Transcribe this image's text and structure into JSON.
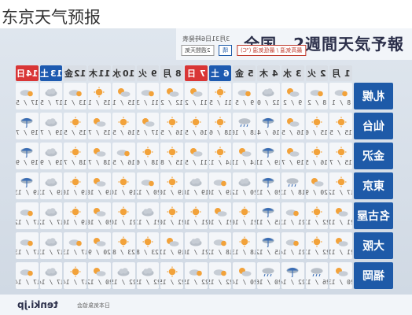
{
  "page": {
    "title": "东京天气预报"
  },
  "header": {
    "title": "全国　2週間天気予報",
    "date": "3月31日6時発表"
  },
  "legend": [
    {
      "label": "2週間天気",
      "style": "plain"
    },
    {
      "label": "晴",
      "style": "blue"
    },
    {
      "label": "最高気温 / 最低気温 (℃)",
      "style": "red"
    }
  ],
  "days": [
    {
      "num": "1",
      "name": "月",
      "type": "weekday"
    },
    {
      "num": "2",
      "name": "火",
      "type": "weekday"
    },
    {
      "num": "3",
      "name": "水",
      "type": "weekday"
    },
    {
      "num": "4",
      "name": "木",
      "type": "weekday"
    },
    {
      "num": "5",
      "name": "金",
      "type": "weekday"
    },
    {
      "num": "6",
      "name": "土",
      "type": "sat"
    },
    {
      "num": "7",
      "name": "日",
      "type": "sun"
    },
    {
      "num": "8",
      "name": "月",
      "type": "weekday"
    },
    {
      "num": "9",
      "name": "火",
      "type": "weekday"
    },
    {
      "num": "10",
      "name": "水",
      "type": "weekday"
    },
    {
      "num": "11",
      "name": "木",
      "type": "weekday"
    },
    {
      "num": "12",
      "name": "金",
      "type": "weekday"
    },
    {
      "num": "13",
      "name": "土",
      "type": "sat"
    },
    {
      "num": "14",
      "name": "日",
      "type": "sun"
    }
  ],
  "cities": [
    {
      "name": "札幌",
      "forecast": [
        {
          "icon": "cloud-sun",
          "temps": "8 / 1"
        },
        {
          "icon": "cloud-sun",
          "temps": "8 / 2"
        },
        {
          "icon": "sun-cloud",
          "temps": "9 / 2"
        },
        {
          "icon": "cloud",
          "temps": "12 / 0"
        },
        {
          "icon": "cloud-sun",
          "temps": "9 / 5"
        },
        {
          "icon": "sun",
          "temps": "11 / 5"
        },
        {
          "icon": "sun-cloud",
          "temps": "11 / 2"
        },
        {
          "icon": "sun-cloud",
          "temps": "12 / 2"
        },
        {
          "icon": "cloud-sun",
          "temps": "11 / 3"
        },
        {
          "icon": "sun-cloud",
          "temps": "15 / 1"
        },
        {
          "icon": "sun",
          "temps": "15 / 1"
        },
        {
          "icon": "cloud-sun",
          "temps": "13 / 1"
        },
        {
          "icon": "cloud",
          "temps": "17 / 5"
        },
        {
          "icon": "cloud-sun",
          "temps": "17 / 5"
        }
      ]
    },
    {
      "name": "仙台",
      "forecast": [
        {
          "icon": "sun",
          "temps": "15 / 5"
        },
        {
          "icon": "sun",
          "temps": "15 / 6"
        },
        {
          "icon": "sun-cloud",
          "temps": "16 / 5"
        },
        {
          "icon": "rain",
          "temps": "16 / 4"
        },
        {
          "icon": "cloud-rain",
          "temps": "18 / 10"
        },
        {
          "icon": "sun",
          "temps": "18 / 6"
        },
        {
          "icon": "sun",
          "temps": "16 / 5"
        },
        {
          "icon": "sun",
          "temps": "16 / 5"
        },
        {
          "icon": "sun-cloud",
          "temps": "17 / 5"
        },
        {
          "icon": "sun",
          "temps": "16 / 5"
        },
        {
          "icon": "sun-cloud",
          "temps": "15 / 7"
        },
        {
          "icon": "sun",
          "temps": "15 / 5"
        },
        {
          "icon": "cloud",
          "temps": "19 / 7"
        },
        {
          "icon": "rain",
          "temps": "19 / 7"
        }
      ]
    },
    {
      "name": "金沢",
      "forecast": [
        {
          "icon": "sun",
          "temps": "15 / 7"
        },
        {
          "icon": "sun",
          "temps": "16 / 5"
        },
        {
          "icon": "sun-cloud",
          "temps": "19 / 7"
        },
        {
          "icon": "rain",
          "temps": "19 / 11"
        },
        {
          "icon": "sun-cloud",
          "temps": "14 / 11"
        },
        {
          "icon": "sun",
          "temps": "14 / 11"
        },
        {
          "icon": "sun-cloud",
          "temps": "11 / 5"
        },
        {
          "icon": "sun",
          "temps": "15 / 8"
        },
        {
          "icon": "sun",
          "temps": "18 / 6"
        },
        {
          "icon": "cloud-sun",
          "temps": "16 / 5"
        },
        {
          "icon": "sun-cloud",
          "temps": "18 / 7"
        },
        {
          "icon": "sun",
          "temps": "18 / 7"
        },
        {
          "icon": "cloud",
          "temps": "19 / 9"
        },
        {
          "icon": "rain",
          "temps": "19 / 9"
        }
      ]
    },
    {
      "name": "東京",
      "forecast": [
        {
          "icon": "sun",
          "temps": "17 / 12"
        },
        {
          "icon": "sun-cloud",
          "temps": "20 / 9"
        },
        {
          "icon": "cloud-rain",
          "temps": "18 / 13"
        },
        {
          "icon": "rain",
          "temps": "20 / 13"
        },
        {
          "icon": "cloud",
          "temps": "20 / 12"
        },
        {
          "icon": "cloud-sun",
          "temps": "19 / 10"
        },
        {
          "icon": "cloud",
          "temps": "19 / 10"
        },
        {
          "icon": "sun",
          "temps": "19 / 10"
        },
        {
          "icon": "cloud-sun",
          "temps": "20 / 12"
        },
        {
          "icon": "sun",
          "temps": "19 / 10"
        },
        {
          "icon": "sun-cloud",
          "temps": "19 / 10"
        },
        {
          "icon": "sun",
          "temps": "19 / 10"
        },
        {
          "icon": "cloud",
          "temps": "19 / 13"
        },
        {
          "icon": "rain",
          "temps": "19 / 13"
        }
      ]
    },
    {
      "name": "名古屋",
      "forecast": [
        {
          "icon": "sun-cloud",
          "temps": "21 / 11"
        },
        {
          "icon": "sun",
          "temps": "22 / 11"
        },
        {
          "icon": "cloud-sun",
          "temps": "21 / 13"
        },
        {
          "icon": "rain",
          "temps": "15 / 11"
        },
        {
          "icon": "sun",
          "temps": "21 / 10"
        },
        {
          "icon": "sun-cloud",
          "temps": "21 / 10"
        },
        {
          "icon": "sun",
          "temps": "21 / 10"
        },
        {
          "icon": "sun",
          "temps": "21 / 10"
        },
        {
          "icon": "cloud",
          "temps": "21 / 11"
        },
        {
          "icon": "sun",
          "temps": "21 / 10"
        },
        {
          "icon": "sun-cloud",
          "temps": "20 / 10"
        },
        {
          "icon": "sun",
          "temps": "19 / 10"
        },
        {
          "icon": "cloud",
          "temps": "17 / 12"
        },
        {
          "icon": "cloud-sun",
          "temps": "17 / 12"
        }
      ]
    },
    {
      "name": "大阪",
      "forecast": [
        {
          "icon": "sun-cloud",
          "temps": "21 / 11"
        },
        {
          "icon": "sun",
          "temps": "22 / 11"
        },
        {
          "icon": "cloud-sun",
          "temps": "21 / 14"
        },
        {
          "icon": "rain",
          "temps": "15 / 12"
        },
        {
          "icon": "sun",
          "temps": "18 / 13"
        },
        {
          "icon": "cloud-sun",
          "temps": "18 / 12"
        },
        {
          "icon": "cloud",
          "temps": "21 / 10"
        },
        {
          "icon": "sun-cloud",
          "temps": "19 / 11"
        },
        {
          "icon": "sun",
          "temps": "23 / 8"
        },
        {
          "icon": "sun",
          "temps": "23 / 8"
        },
        {
          "icon": "sun-cloud",
          "temps": "20 / 9"
        },
        {
          "icon": "cloud-sun",
          "temps": "17 / 13"
        },
        {
          "icon": "cloud",
          "temps": "17 / 13"
        },
        {
          "icon": "cloud-sun",
          "temps": "17 / 13"
        }
      ]
    },
    {
      "name": "福岡",
      "forecast": [
        {
          "icon": "sun-cloud",
          "temps": "20 / 13"
        },
        {
          "icon": "cloud-rain",
          "temps": "26 / 11"
        },
        {
          "icon": "rain",
          "temps": "22 / 14"
        },
        {
          "icon": "cloud-rain",
          "temps": "20 / 16"
        },
        {
          "icon": "sun-cloud",
          "temps": "20 / 14"
        },
        {
          "icon": "cloud-sun",
          "temps": "22 / 15"
        },
        {
          "icon": "cloud-sun",
          "temps": "22 / 15"
        },
        {
          "icon": "sun",
          "temps": "22 / 15"
        },
        {
          "icon": "cloud",
          "temps": "22 / 15"
        },
        {
          "icon": "cloud",
          "temps": "22 / 15"
        },
        {
          "icon": "sun-cloud",
          "temps": "20 / 12"
        },
        {
          "icon": "sun",
          "temps": "17 / 14"
        },
        {
          "icon": "cloud",
          "temps": "17 / 14"
        },
        {
          "icon": "cloud-sun",
          "temps": "17 / 14"
        }
      ]
    }
  ],
  "footer": {
    "logo": "tenki.jp",
    "credit": "日本気象協会"
  }
}
